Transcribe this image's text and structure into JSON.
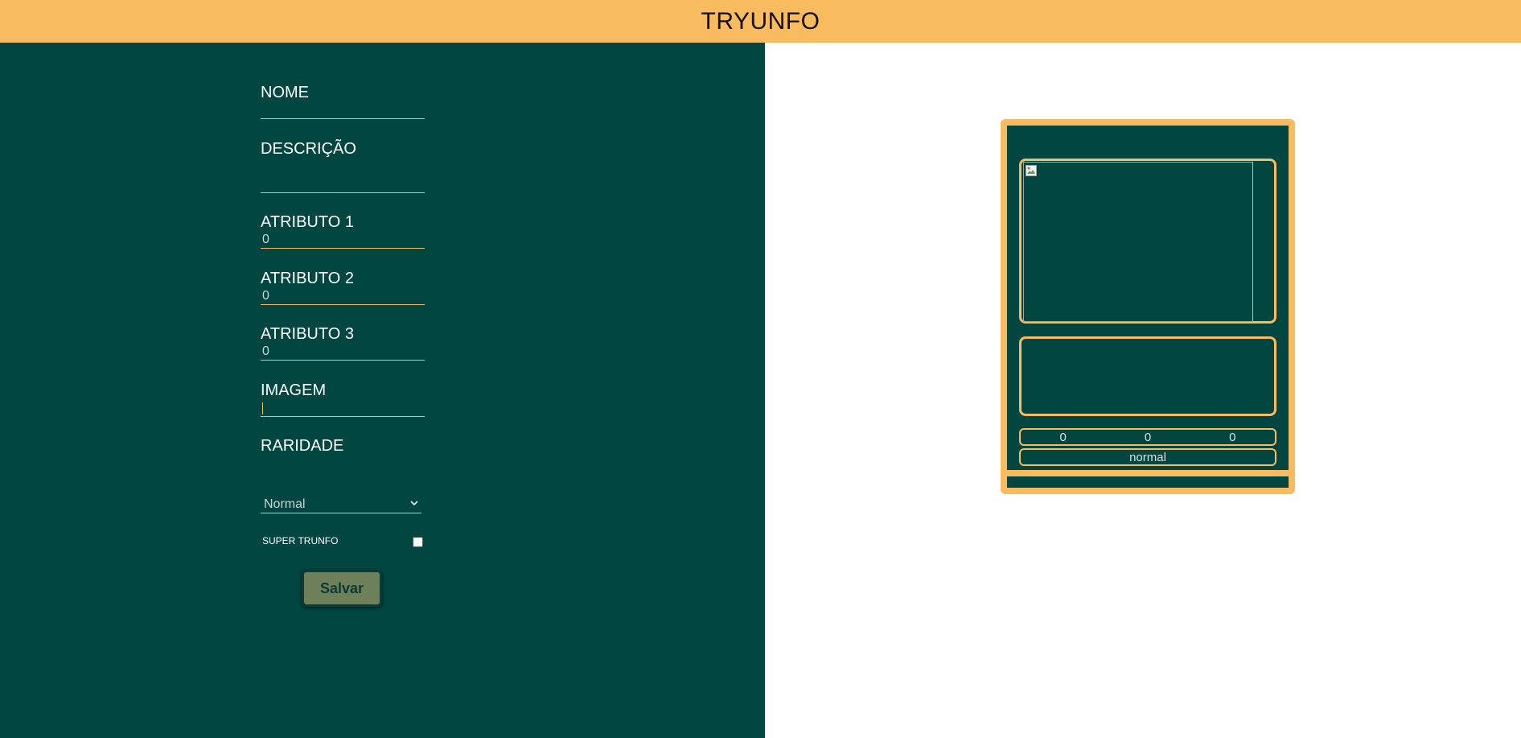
{
  "header": {
    "title": "TRYUNFO"
  },
  "form": {
    "name": {
      "label": "NOME",
      "value": ""
    },
    "description": {
      "label": "DESCRIÇÃO",
      "value": ""
    },
    "attr1": {
      "label": "ATRIBUTO 1",
      "value": "0"
    },
    "attr2": {
      "label": "ATRIBUTO 2",
      "value": "0"
    },
    "attr3": {
      "label": "ATRIBUTO 3",
      "value": "0"
    },
    "image": {
      "label": "IMAGEM",
      "value": ""
    },
    "rarity": {
      "label": "RARIDADE",
      "selected": "Normal"
    },
    "super_trunfo": {
      "label": "SUPER TRUNFO",
      "checked": false
    },
    "save_label": "Salvar"
  },
  "card": {
    "name": "",
    "description": "",
    "attr1": "0",
    "attr2": "0",
    "attr3": "0",
    "rarity": "normal"
  },
  "colors": {
    "accent": "#f9bb5f",
    "panel": "#014641",
    "button": "#6d805a"
  },
  "icons": {
    "select_chevron": "chevron-down-icon",
    "broken_image": "broken-image-icon"
  }
}
